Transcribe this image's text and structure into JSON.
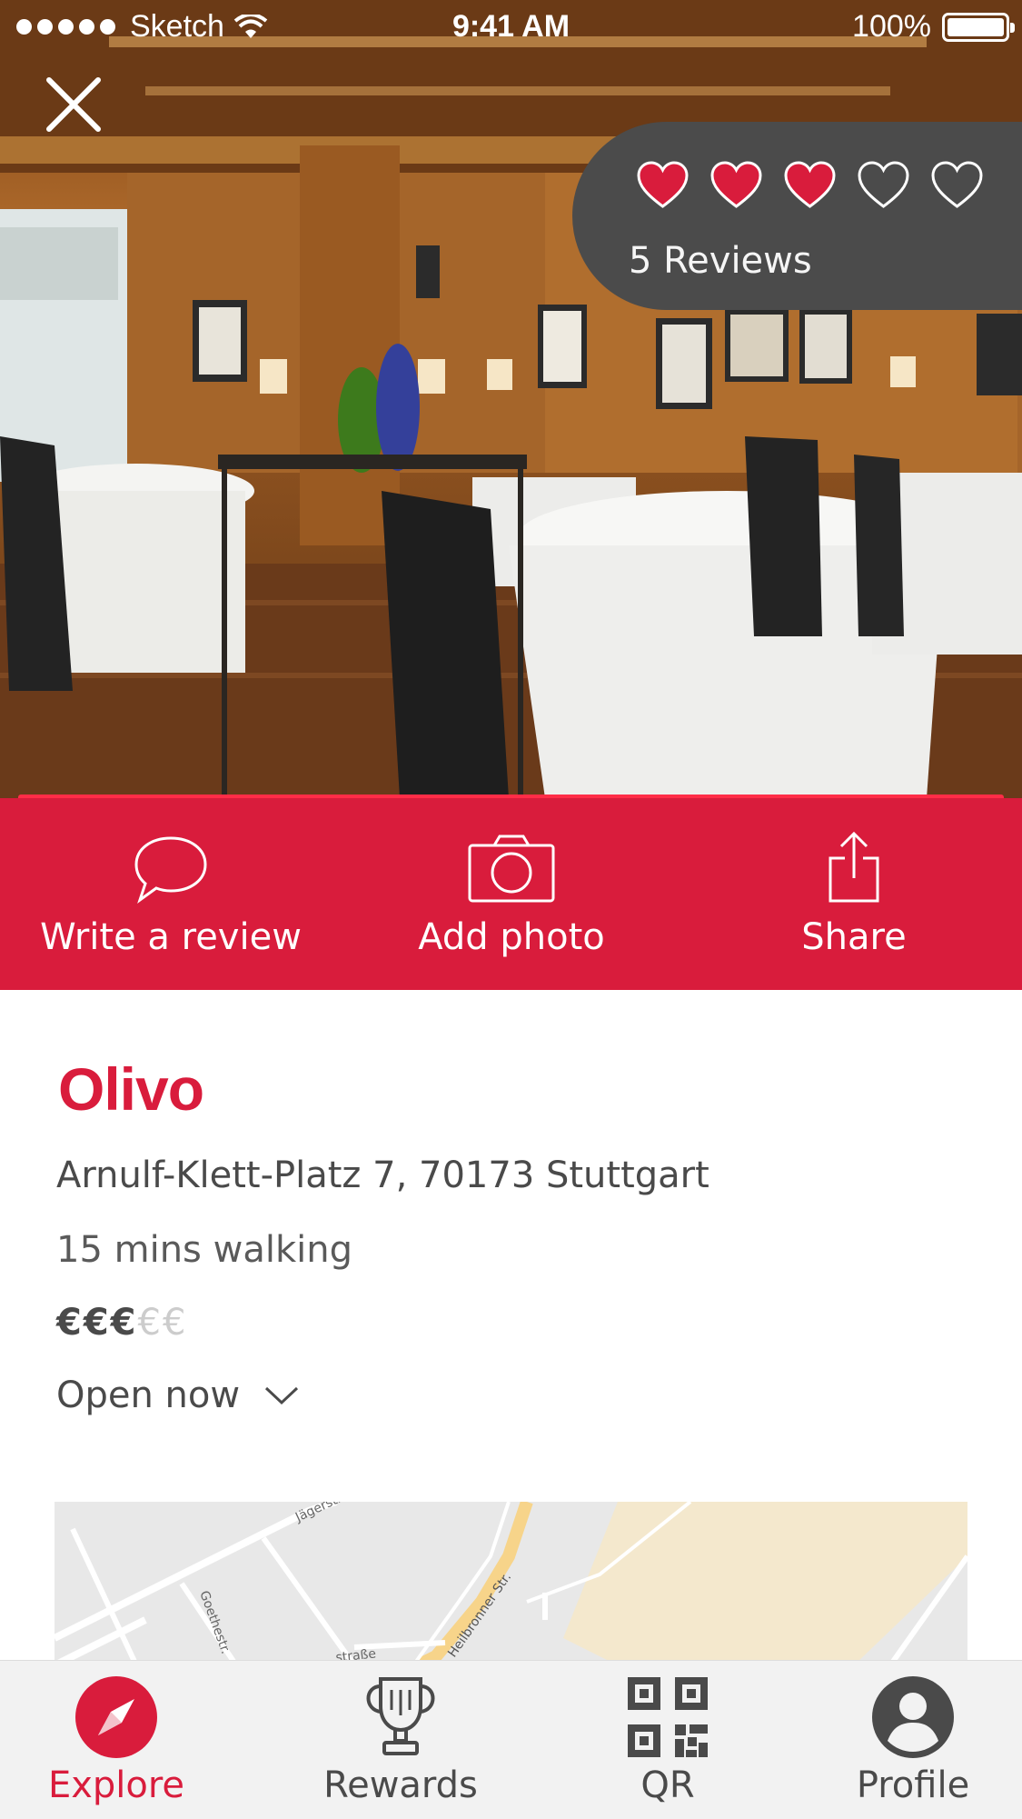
{
  "status_bar": {
    "carrier": "Sketch",
    "time": "9:41 AM",
    "battery": "100%"
  },
  "rating": {
    "hearts_filled": 3,
    "hearts_total": 5,
    "reviews_label": "5 Reviews"
  },
  "actions": {
    "write_review": "Write a review",
    "add_photo": "Add photo",
    "share": "Share"
  },
  "restaurant": {
    "name": "Olivo",
    "address": "Arnulf-Klett-Platz 7, 70173 Stuttgart",
    "walking": "15 mins walking",
    "price_active": "€€€",
    "price_inactive": "€€",
    "hours": "Open now"
  },
  "map": {
    "streets": [
      "Jägerstr.",
      "Goethestr.",
      "Heilbronner Str.",
      "straße"
    ]
  },
  "tabs": [
    {
      "label": "Explore",
      "icon": "compass-icon",
      "active": true
    },
    {
      "label": "Rewards",
      "icon": "trophy-icon",
      "active": false
    },
    {
      "label": "QR",
      "icon": "qr-code-icon",
      "active": false
    },
    {
      "label": "Profile",
      "icon": "profile-icon",
      "active": false
    }
  ],
  "colors": {
    "accent": "#d91c3c",
    "accent_bar": "#ff2d47",
    "pill": "#4b4b4b",
    "tabbar": "#f2f2f2"
  }
}
